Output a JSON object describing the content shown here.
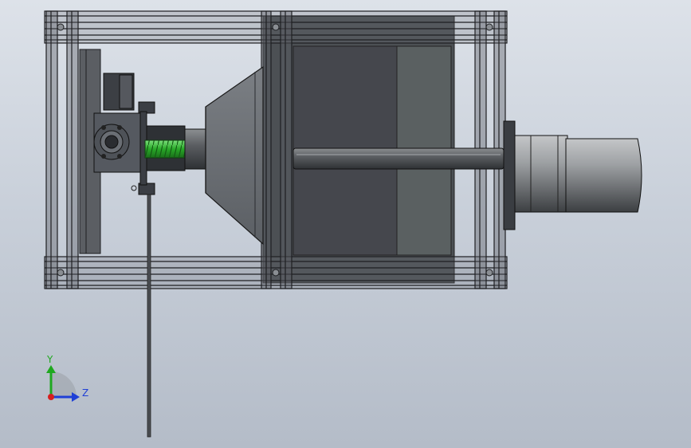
{
  "viewport": {
    "background_top": "#dde2e9",
    "background_bottom": "#b4bcc8"
  },
  "model": {
    "frame_color": "#2b2d30",
    "panel_color": "#4a4c52",
    "housing_color": "#5a5f60",
    "shaft_color": "#6f7276",
    "leadscrew_color": "#3cbf3c",
    "motor_color": "#8a8d90"
  },
  "triad": {
    "y_label": "Y",
    "z_label": "Z",
    "y_color": "#1fa81f",
    "z_color": "#1f3fd6",
    "x_color": "#d61f1f"
  }
}
